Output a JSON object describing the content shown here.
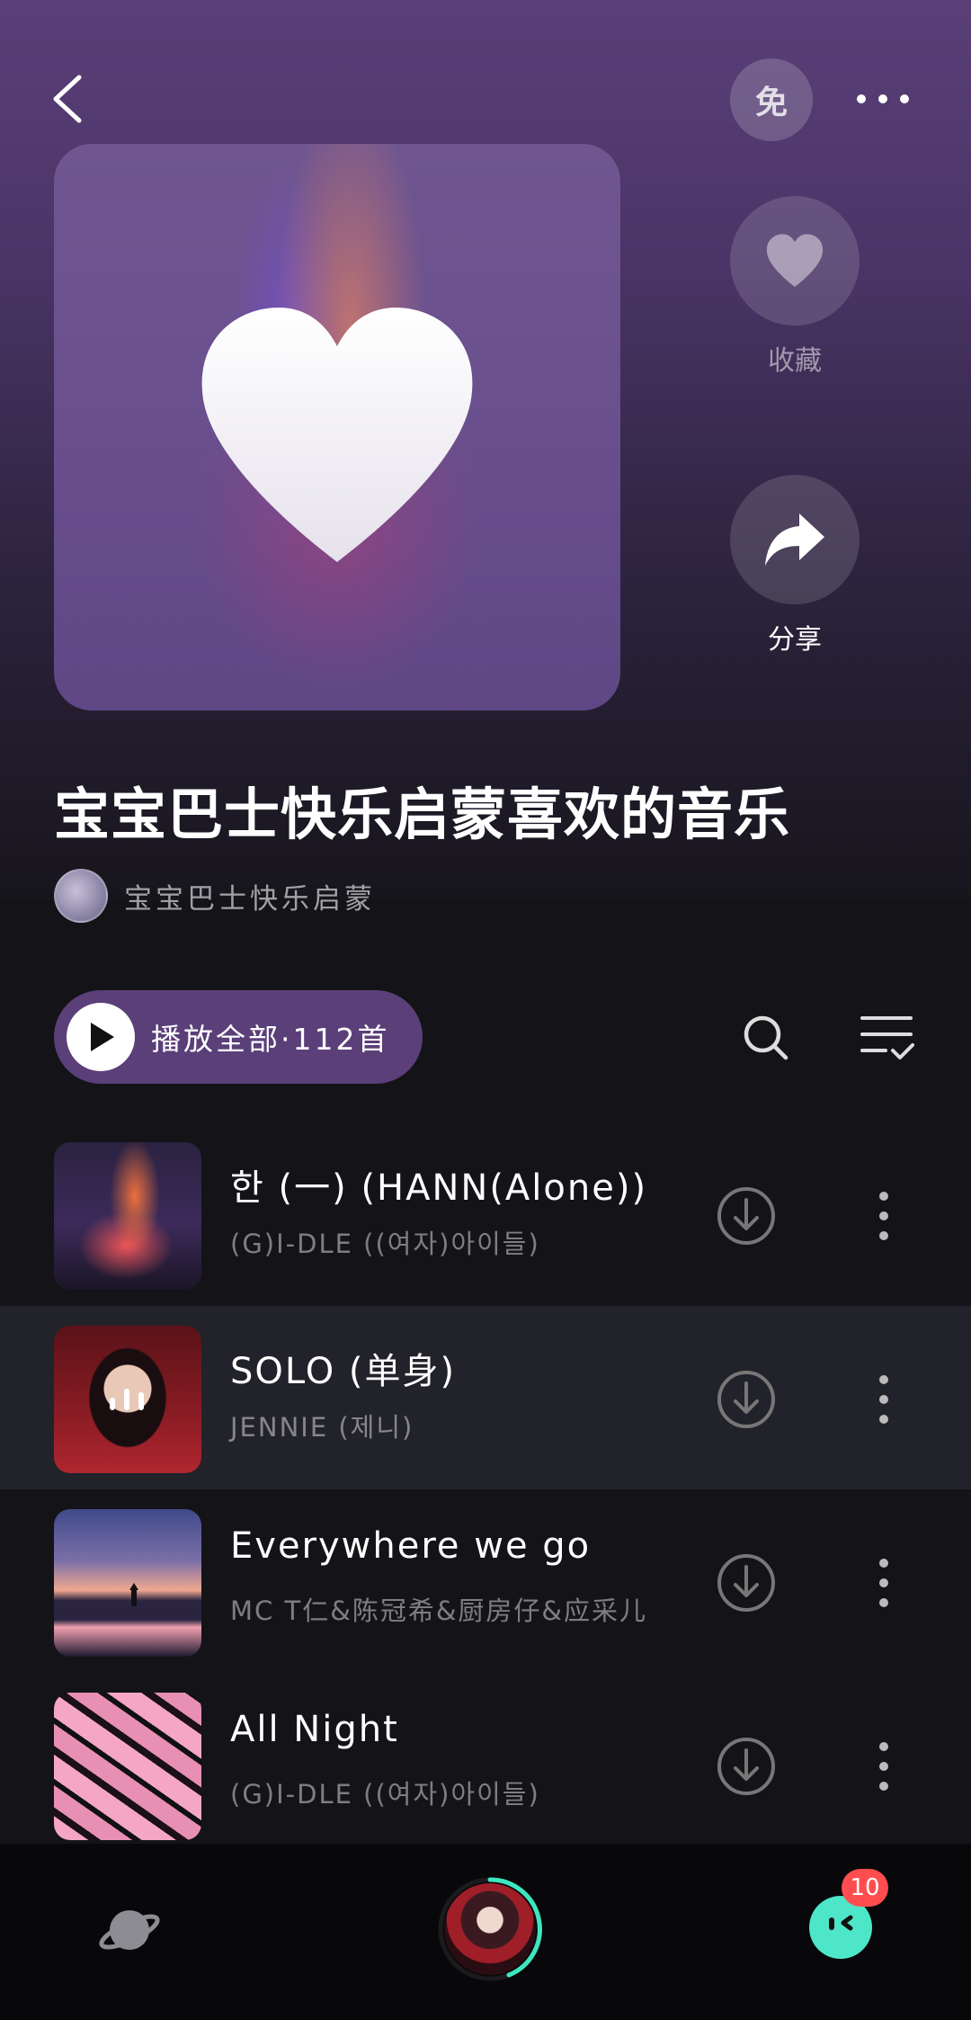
{
  "header": {
    "free_label": "免"
  },
  "side_actions": {
    "favorite_label": "收藏",
    "share_label": "分享"
  },
  "playlist": {
    "title": "宝宝巴士快乐启蒙喜欢的音乐",
    "creator": "宝宝巴士快乐启蒙"
  },
  "controls": {
    "play_all_label": "播放全部·112首"
  },
  "songs": [
    {
      "name": "한 (一) (HANN(Alone))",
      "artist": "(G)I-DLE ((여자)아이들)",
      "playing": false
    },
    {
      "name": "SOLO (单身)",
      "artist": "JENNIE (제니)",
      "playing": true
    },
    {
      "name": "Everywhere we go",
      "artist": "MC T仁&陈冠希&厨房仔&应采儿",
      "playing": false
    },
    {
      "name": "All Night",
      "artist": "(G)I-DLE ((여자)아이들)",
      "playing": false
    }
  ],
  "bottom_nav": {
    "badge_count": "10"
  },
  "colors": {
    "accent": "#5b3f79",
    "playing_ring": "#3ee6c0",
    "badge": "#ff4d4f"
  }
}
